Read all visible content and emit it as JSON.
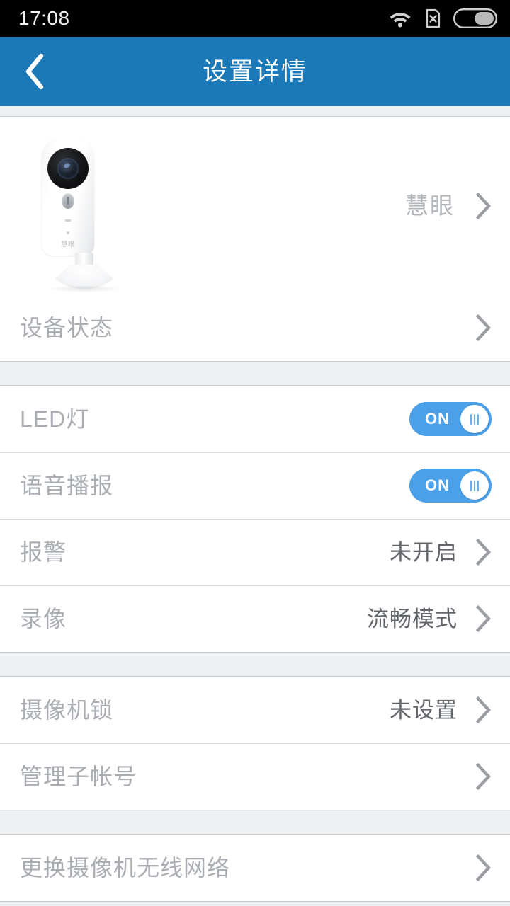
{
  "statusbar": {
    "time": "17:08",
    "icons": [
      {
        "name": "wifi-icon",
        "label": "wifi"
      },
      {
        "name": "sim-card-no-service-icon",
        "label": "X"
      },
      {
        "name": "battery-icon",
        "label": "battery"
      }
    ]
  },
  "header": {
    "title": "设置详情",
    "back_icon": "back-chevron-icon",
    "accent_color": "#1b79b8"
  },
  "device": {
    "name": "慧眼",
    "image_alt": "白色家用摄像机",
    "chevron": "chevron-right-icon"
  },
  "sections": [
    {
      "rows": [
        {
          "label": "设备状态",
          "value": "",
          "type": "link"
        }
      ]
    },
    {
      "rows": [
        {
          "label": "LED灯",
          "value": "",
          "type": "toggle",
          "toggle_state": "ON"
        },
        {
          "label": "语音播报",
          "value": "",
          "type": "toggle",
          "toggle_state": "ON"
        },
        {
          "label": "报警",
          "value": "未开启",
          "type": "link"
        },
        {
          "label": "录像",
          "value": "流畅模式",
          "type": "link"
        }
      ]
    },
    {
      "rows": [
        {
          "label": "摄像机锁",
          "value": "未设置",
          "type": "link"
        },
        {
          "label": "管理子帐号",
          "value": "",
          "type": "link"
        }
      ]
    },
    {
      "rows": [
        {
          "label": "更换摄像机无线网络",
          "value": "",
          "type": "link"
        }
      ]
    }
  ],
  "colors": {
    "header_blue": "#1b79b8",
    "toggle_on": "#4ba0e8",
    "page_bg": "#eef1f4",
    "label_gray": "#aaaeb3",
    "value_gray": "#62666b"
  }
}
